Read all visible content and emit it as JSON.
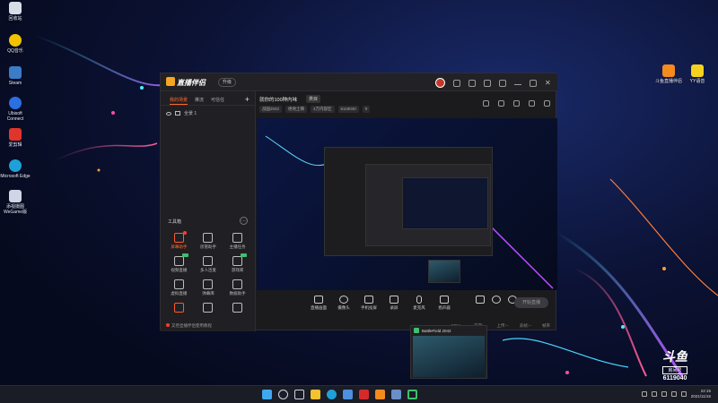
{
  "desktop": {
    "icons_left": [
      {
        "label": "回收站",
        "icon": "recycle-bin-icon",
        "color": "#d8dde8"
      },
      {
        "label": "QQ音乐",
        "icon": "qq-music-icon",
        "color": "#f2c400"
      },
      {
        "label": "Steam",
        "icon": "steam-icon",
        "color": "#3a7cc8"
      },
      {
        "label": "Ubisoft Connect",
        "icon": "ubisoft-icon",
        "color": "#2b6fe0"
      },
      {
        "label": "爱剪辑",
        "icon": "editor-icon",
        "color": "#e0352b"
      },
      {
        "label": "Microsoft Edge",
        "icon": "edge-icon",
        "color": "#1fa0d8"
      },
      {
        "label": "添视摄图 WeGame版",
        "icon": "wegame-icon",
        "color": "#cfd6e6"
      }
    ],
    "icons_right": [
      {
        "label": "斗鱼直播伴侣",
        "icon": "douyu-companion-icon",
        "color": "#f58a1f"
      },
      {
        "label": "YY语音",
        "icon": "yy-voice-icon",
        "color": "#f5d21f"
      }
    ]
  },
  "app": {
    "logo_text": "直播伴侣",
    "upgrade_label": "升级",
    "left_tabs": [
      "我的场景",
      "推流",
      "可信任"
    ],
    "scene_label": "全景 1",
    "toolbox_title": "工具箱",
    "tools": [
      {
        "label": "屏幕助手",
        "icon": "screen-assistant-icon",
        "hot": true,
        "badge": "dot"
      },
      {
        "label": "房管助手",
        "icon": "room-manager-icon",
        "hot": false,
        "badge": ""
      },
      {
        "label": "主播任务",
        "icon": "streamer-task-icon",
        "hot": false,
        "badge": ""
      },
      {
        "label": "视频直播",
        "icon": "video-live-icon",
        "hot": false,
        "badge": "new"
      },
      {
        "label": "多人连麦",
        "icon": "multi-mic-icon",
        "hot": false,
        "badge": ""
      },
      {
        "label": "游戏库",
        "icon": "game-library-icon",
        "hot": false,
        "badge": "new"
      },
      {
        "label": "虚拟直播",
        "icon": "virtual-live-icon",
        "hot": false,
        "badge": ""
      },
      {
        "label": "弹幕库",
        "icon": "danmaku-icon",
        "hot": false,
        "badge": ""
      },
      {
        "label": "数据助手",
        "icon": "data-assistant-icon",
        "hot": false,
        "badge": ""
      },
      {
        "label": "",
        "icon": "cinema-icon",
        "hot": false,
        "badge": ""
      },
      {
        "label": "",
        "icon": "download-icon",
        "hot": false,
        "badge": ""
      },
      {
        "label": "",
        "icon": "car-icon",
        "hot": false,
        "badge": ""
      }
    ],
    "bottom_note": "又叁显播伴侣使用教程",
    "room": {
      "title": "就你的100种内味",
      "tag": "类目",
      "meta": [
        "战国2042",
        "绝地土镇",
        "4万内容区",
        "6119040",
        "0"
      ]
    },
    "controls": [
      {
        "label": "直播画面",
        "icon": "live-screen-icon"
      },
      {
        "label": "摄像头",
        "icon": "camera-icon"
      },
      {
        "label": "手机投屏",
        "icon": "phone-cast-icon"
      },
      {
        "label": "录屏",
        "icon": "record-icon"
      },
      {
        "label": "麦克风",
        "icon": "microphone-icon"
      },
      {
        "label": "扬声器",
        "icon": "speaker-icon"
      }
    ],
    "go_live_label": "开始直播",
    "stats": [
      "CPU:--",
      "内存:--",
      "上传:--",
      "丢帧:--",
      "帧率"
    ]
  },
  "mini_window": {
    "title": "BattleField 2042"
  },
  "watermark": {
    "logo": "斗鱼",
    "sub": "房间号",
    "room_id": "6119040"
  },
  "taskbar": {
    "apps": [
      {
        "icon": "windows-start-icon",
        "color": "#3fa7f0"
      },
      {
        "icon": "search-icon",
        "color": "#cfd6e6"
      },
      {
        "icon": "task-view-icon",
        "color": "#cfd6e6"
      },
      {
        "icon": "file-explorer-icon",
        "color": "#f2c230"
      },
      {
        "icon": "edge-icon",
        "color": "#1fa0d8"
      },
      {
        "icon": "store-icon",
        "color": "#4d8fe0"
      },
      {
        "icon": "netease-icon",
        "color": "#d42a2a"
      },
      {
        "icon": "douyu-icon",
        "color": "#f58a1f"
      },
      {
        "icon": "steam-icon",
        "color": "#6a8fc8"
      },
      {
        "icon": "companion-icon",
        "color": "#3ec06d"
      }
    ],
    "clock_time": "22:15",
    "clock_date": "2021/11/15"
  }
}
